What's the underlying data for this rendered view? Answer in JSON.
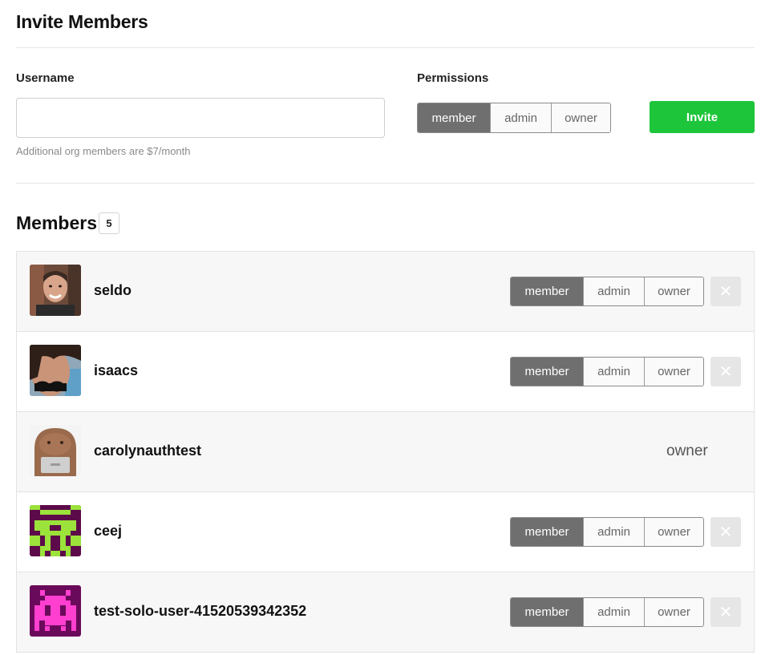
{
  "invite": {
    "title": "Invite Members",
    "username_label": "Username",
    "username_value": "",
    "username_placeholder": "",
    "hint": "Additional org members are $7/month",
    "permissions_label": "Permissions",
    "permissions": [
      "member",
      "admin",
      "owner"
    ],
    "selected_permission": "member",
    "invite_button": "Invite",
    "invite_color": "#1dc53a"
  },
  "members": {
    "title": "Members",
    "count": "5",
    "roles": [
      "member",
      "admin",
      "owner"
    ],
    "remove_symbol": "✕",
    "list": [
      {
        "name": "seldo",
        "role": "member",
        "avatar": "photo-avatar"
      },
      {
        "name": "isaacs",
        "role": "member",
        "avatar": "photo-avatar"
      },
      {
        "name": "carolynauthtest",
        "role": "owner",
        "avatar": "cartoon-avatar"
      },
      {
        "name": "ceej",
        "role": "member",
        "avatar": "pixel-avatar-green"
      },
      {
        "name": "test-solo-user-41520539342352",
        "role": "member",
        "avatar": "pixel-avatar-pink"
      }
    ]
  }
}
